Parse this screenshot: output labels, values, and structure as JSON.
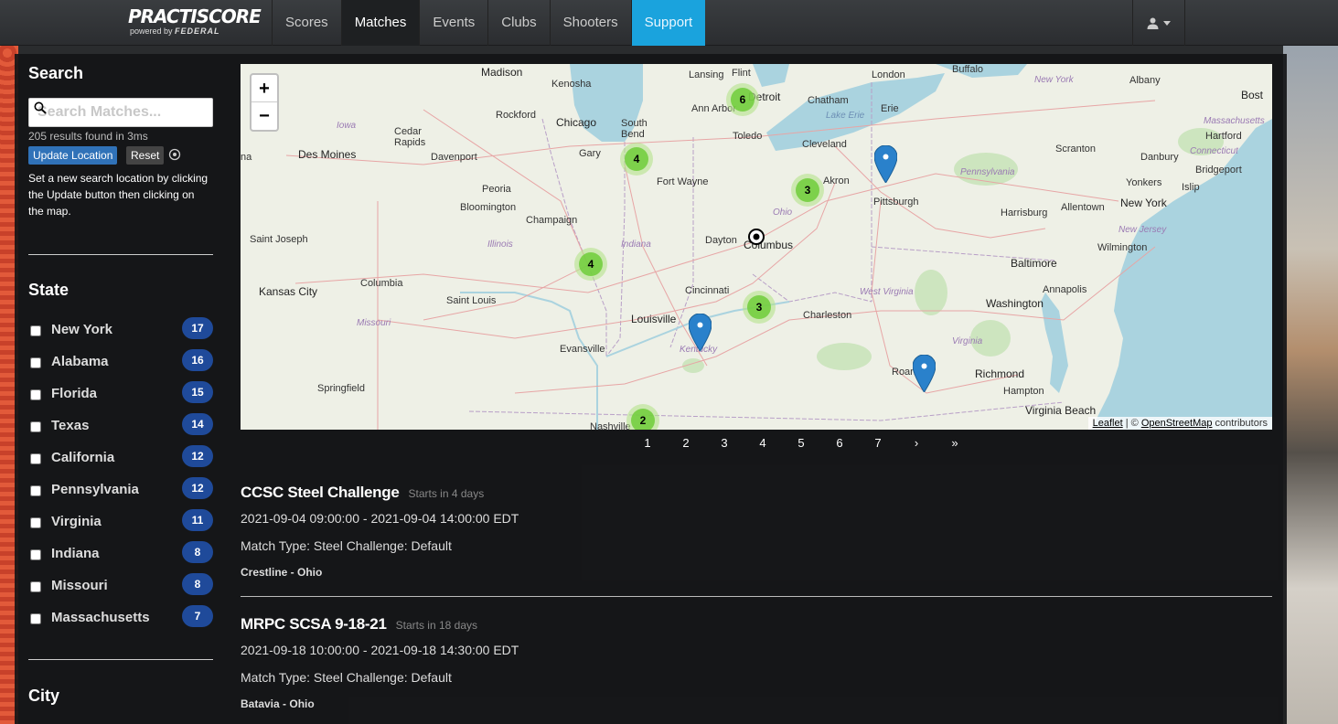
{
  "navbar": {
    "brand_main": "PRACTISCORE",
    "brand_sub_prefix": "powered by",
    "brand_sub_name": "FEDERAL",
    "items": [
      {
        "label": "Scores"
      },
      {
        "label": "Matches"
      },
      {
        "label": "Events"
      },
      {
        "label": "Clubs"
      },
      {
        "label": "Shooters"
      },
      {
        "label": "Support"
      }
    ],
    "active": "Matches",
    "accent_color": "#1aa3dd"
  },
  "sidebar": {
    "search_heading": "Search",
    "search_placeholder": "Search Matches...",
    "results_text": "205 results found in 3ms",
    "update_button": "Update Location",
    "reset_button": "Reset",
    "help_text": "Set a new search location by clicking the Update button then clicking on the map.",
    "state_heading": "State",
    "states": [
      {
        "name": "New York",
        "count": "17"
      },
      {
        "name": "Alabama",
        "count": "16"
      },
      {
        "name": "Florida",
        "count": "15"
      },
      {
        "name": "Texas",
        "count": "14"
      },
      {
        "name": "California",
        "count": "12"
      },
      {
        "name": "Pennsylvania",
        "count": "12"
      },
      {
        "name": "Virginia",
        "count": "11"
      },
      {
        "name": "Indiana",
        "count": "8"
      },
      {
        "name": "Missouri",
        "count": "8"
      },
      {
        "name": "Massachusetts",
        "count": "7"
      }
    ],
    "city_heading": "City"
  },
  "map": {
    "zoom_in": "+",
    "zoom_out": "−",
    "attribution_link1": "Leaflet",
    "attribution_sep": " | © ",
    "attribution_link2": "OpenStreetMap",
    "attribution_tail": " contributors",
    "clusters": [
      "6",
      "4",
      "3",
      "4",
      "3",
      "2"
    ],
    "labels": {
      "madison": "Madison",
      "kenosha": "Kenosha",
      "lansing": "Lansing",
      "flint": "Flint",
      "buffalo": "Buffalo",
      "albany": "Albany",
      "new_york_state": "New York",
      "boston": "Bost",
      "iowa": "Iowa",
      "rockford": "Rockford",
      "chicago": "Chicago",
      "south_bend": "South Bend",
      "ann_arbor": "Ann Arbor",
      "detroit": "Detroit",
      "chatham": "Chatham",
      "london": "London",
      "lake_erie": "Lake Erie",
      "erie": "Erie",
      "massachusetts": "Massachusetts",
      "hartford": "Hartford",
      "cedar_rapids": "Cedar Rapids",
      "toledo": "Toledo",
      "cleveland": "Cleveland",
      "scranton": "Scranton",
      "connecticut": "Connecticut",
      "danbury": "Danbury",
      "des_moines": "Des Moines",
      "davenport": "Davenport",
      "gary": "Gary",
      "pennsylvania": "Pennsylvania",
      "bridgeport": "Bridgeport",
      "fort_wayne": "Fort Wayne",
      "akron": "Akron",
      "yonkers": "Yonkers",
      "islip": "Islip",
      "peoria": "Peoria",
      "pittsburgh": "Pittsburgh",
      "new_york_city": "New York",
      "bloomington": "Bloomington",
      "ohio": "Ohio",
      "harrisburg": "Harrisburg",
      "allentown": "Allentown",
      "champaign": "Champaign",
      "new_jersey": "New Jersey",
      "saint_joseph": "Saint Joseph",
      "illinois": "Illinois",
      "indiana": "Indiana",
      "dayton": "Dayton",
      "columbus": "Columbus",
      "wilmington": "Wilmington",
      "baltimore": "Baltimore",
      "kansas_city": "Kansas City",
      "columbia": "Columbia",
      "saint_louis": "Saint Louis",
      "cincinnati": "Cincinnati",
      "west_virginia": "West Virginia",
      "annapolis": "Annapolis",
      "washington": "Washington",
      "missouri": "Missouri",
      "louisville": "Louisville",
      "charleston": "Charleston",
      "evansville": "Evansville",
      "kentucky": "Kentucky",
      "virginia": "Virginia",
      "roanoke": "Roanoke",
      "richmond": "Richmond",
      "springfield": "Springfield",
      "hampton": "Hampton",
      "virginia_beach": "Virginia Beach",
      "nashville": "Nashville",
      "left_edge": "na"
    }
  },
  "pagination": [
    "1",
    "2",
    "3",
    "4",
    "5",
    "6",
    "7",
    "›",
    "»"
  ],
  "matches": [
    {
      "title": "CCSC Steel Challenge",
      "starts": "Starts in 4 days",
      "dates": "2021-09-04 09:00:00 - 2021-09-04 14:00:00 EDT",
      "type": "Match Type: Steel Challenge: Default",
      "location": "Crestline - Ohio"
    },
    {
      "title": "MRPC SCSA 9-18-21",
      "starts": "Starts in 18 days",
      "dates": "2021-09-18 10:00:00 - 2021-09-18 14:30:00 EDT",
      "type": "Match Type: Steel Challenge: Default",
      "location": "Batavia - Ohio"
    }
  ]
}
